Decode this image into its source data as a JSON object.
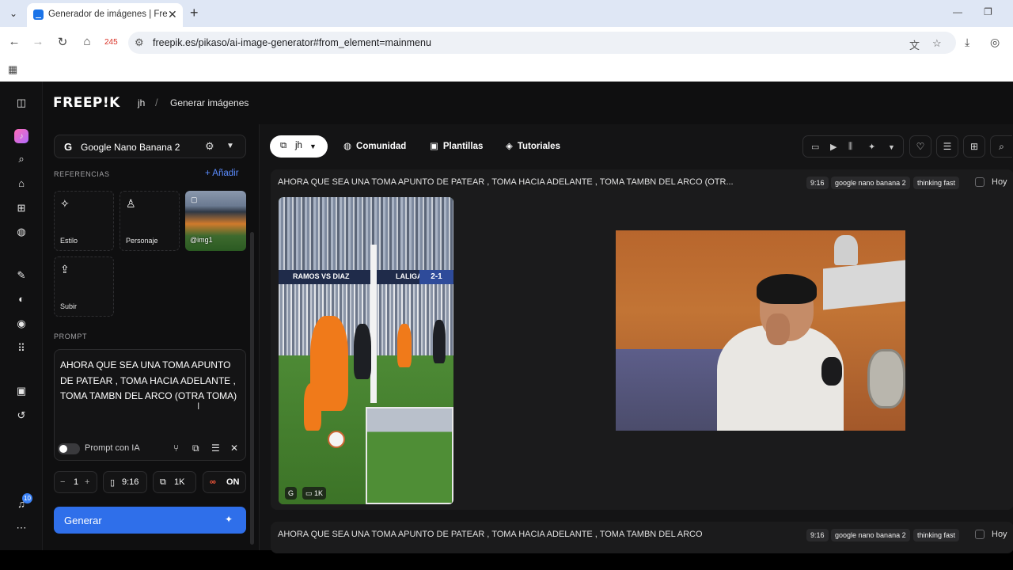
{
  "browser": {
    "tab_title": "Generador de imágenes | Freepik",
    "url": "freepik.es/pikaso/ai-image-generator#from_element=mainmenu",
    "extension_count": "245"
  },
  "app": {
    "logo": "FREEP!K",
    "breadcrumb_user": "jh",
    "breadcrumb_page": "Generar imágenes",
    "notification_count": "10"
  },
  "panel": {
    "model_name": "Google Nano Banana 2",
    "references_label": "REFERENCIAS",
    "add_label": "Añadir",
    "ref_style": "Estilo",
    "ref_character": "Personaje",
    "ref_image": "@img1",
    "ref_upload": "Subir",
    "prompt_label": "PROMPT",
    "prompt_text": "AHORA QUE SEA UNA TOMA APUNTO DE PATEAR , TOMA HACIA ADELANTE , TOMA TAMBN DEL ARCO (OTRA TOMA)",
    "prompt_ai_label": "Prompt con IA",
    "quantity": "1",
    "aspect": "9:16",
    "resolution": "1K",
    "unlimited": "ON",
    "generate_label": "Generar"
  },
  "main": {
    "filter_user": "jh",
    "nav": [
      "Comunidad",
      "Plantillas",
      "Tutoriales"
    ],
    "cards": [
      {
        "prompt": "AHORA QUE SEA UNA TOMA APUNTO DE PATEAR , TOMA HACIA ADELANTE , TOMA TAMBN DEL ARCO (OTR...",
        "aspect": "9:16",
        "model": "google nano banana 2",
        "mode": "thinking fast",
        "date": "Hoy",
        "image_tag_model": "G",
        "image_tag_res": "1K",
        "image_banner_left": "RAMOS VS DIAZ",
        "image_banner_brand": "LALIGA",
        "image_banner_score": "2-1"
      },
      {
        "prompt": "AHORA QUE SEA UNA TOMA APUNTO DE PATEAR , TOMA HACIA ADELANTE , TOMA TAMBN DEL ARCO",
        "aspect": "9:16",
        "model": "google nano banana 2",
        "mode": "thinking fast",
        "date": "Hoy"
      }
    ]
  },
  "colors": {
    "accent": "#2f6fea",
    "background": "#0f0f10",
    "link": "#5b8cff"
  }
}
